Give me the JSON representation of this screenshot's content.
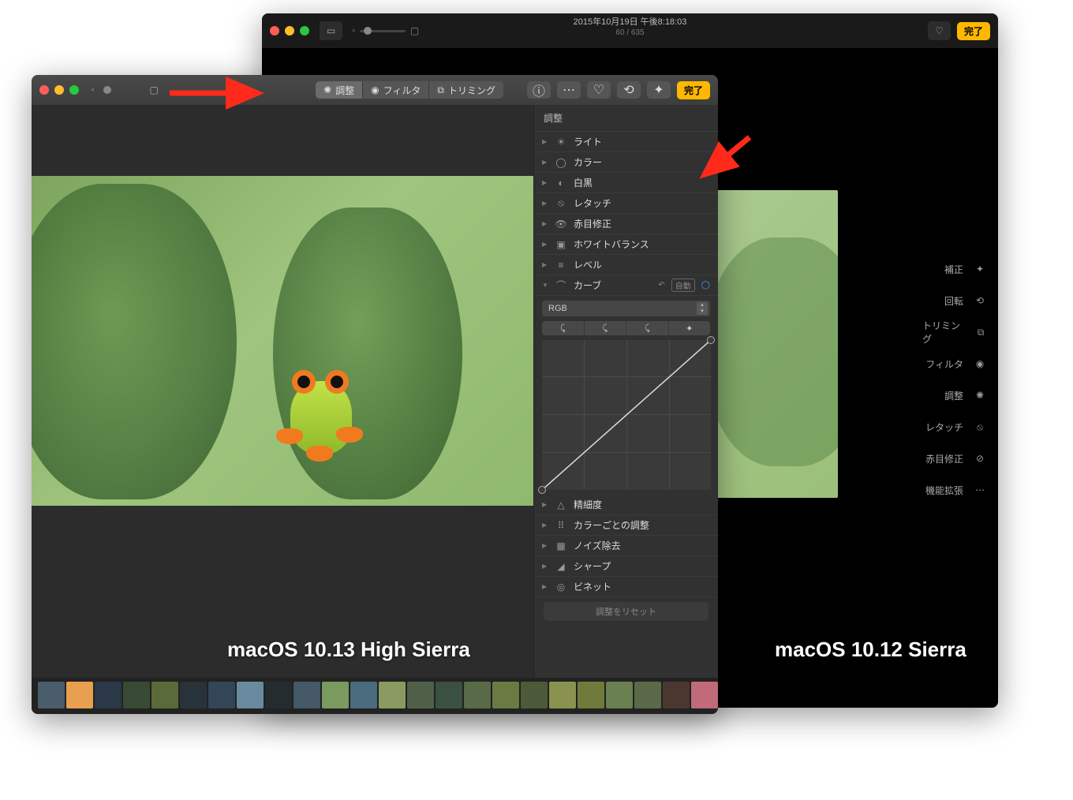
{
  "back": {
    "title": "2015年10月19日 午後8:18:03",
    "counter": "60 / 635",
    "done": "完了",
    "sideTools": [
      {
        "label": "補正",
        "icon": "wand"
      },
      {
        "label": "回転",
        "icon": "rotate"
      },
      {
        "label": "トリミング",
        "icon": "crop"
      },
      {
        "label": "フィルタ",
        "icon": "filter"
      },
      {
        "label": "調整",
        "icon": "adjust"
      },
      {
        "label": "レタッチ",
        "icon": "retouch"
      },
      {
        "label": "赤目修正",
        "icon": "redeye"
      },
      {
        "label": "機能拡張",
        "icon": "more"
      }
    ],
    "caption": "macOS 10.12 Sierra"
  },
  "front": {
    "tabs": [
      {
        "label": "調整",
        "icon": "adjust",
        "active": true
      },
      {
        "label": "フィルタ",
        "icon": "filter",
        "active": false
      },
      {
        "label": "トリミング",
        "icon": "crop",
        "active": false
      }
    ],
    "done": "完了",
    "panel": {
      "header": "調整",
      "items": [
        {
          "label": "ライト",
          "icon": "☀"
        },
        {
          "label": "カラー",
          "icon": "◯"
        },
        {
          "label": "白黒",
          "icon": "◐"
        },
        {
          "label": "レタッチ",
          "icon": "⦸"
        },
        {
          "label": "赤目修正",
          "icon": "👁"
        },
        {
          "label": "ホワイトバランス",
          "icon": "▣"
        },
        {
          "label": "レベル",
          "icon": "≡"
        }
      ],
      "curves": {
        "label": "カーブ",
        "icon": "⌒",
        "auto": "自動",
        "channel": "RGB"
      },
      "items2": [
        {
          "label": "精細度",
          "icon": "△"
        },
        {
          "label": "カラーごとの調整",
          "icon": "⠿"
        },
        {
          "label": "ノイズ除去",
          "icon": "▦"
        },
        {
          "label": "シャープ",
          "icon": "◢"
        },
        {
          "label": "ビネット",
          "icon": "◎"
        }
      ],
      "reset": "調整をリセット"
    },
    "caption": "macOS 10.13 High Sierra"
  },
  "thumbColors": [
    "#4a5d6b",
    "#e8a050",
    "#2a3848",
    "#384a34",
    "#5a6a3a",
    "#28323a",
    "#324658",
    "#6a8aa0",
    "#242c30",
    "#445866",
    "#7a9a60",
    "#4a6a7e",
    "#8a9a60",
    "#506048",
    "#3a5040",
    "#586a48",
    "#6a7a42",
    "#4c5a3a",
    "#8a9250",
    "#707a3a",
    "#6a8050",
    "#5a6a48",
    "#4a3830",
    "#c06a7a",
    "#b04a5a",
    "#7a884e",
    "#a8c070",
    "#c8d8e0",
    "#5a6258"
  ]
}
